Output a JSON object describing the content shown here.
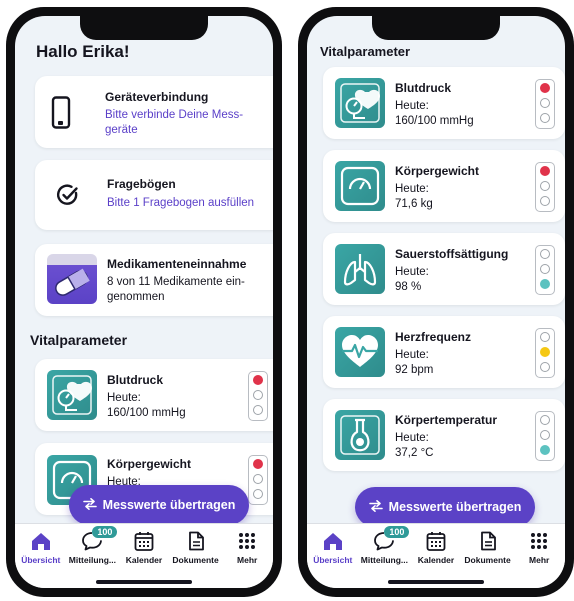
{
  "left_screen": {
    "greeting": "Hallo Erika!",
    "cards": [
      {
        "title": "Geräteverbindung",
        "subtitle_line1": "Bitte verbinde Deine Mess-",
        "subtitle_line2": "geräte",
        "icon": "phone-icon"
      },
      {
        "title": "Fragebögen",
        "subtitle": "Bitte 1 Fragebogen ausfüllen",
        "icon": "checkmark-circle-icon"
      },
      {
        "title": "Medikamenteneinnahme",
        "text_line1": "8 von 11 Medikamente ein-",
        "text_line2": "genommen",
        "icon": "pill-icon"
      }
    ],
    "section_title": "Vitalparameter",
    "vitals": [
      {
        "name": "Blutdruck",
        "label": "Heute:",
        "value": "160/100 mmHg",
        "status": "red"
      },
      {
        "name": "Körpergewicht",
        "label": "Heute:",
        "value": "",
        "status": "red"
      }
    ],
    "button_label": "Messwerte übertragen"
  },
  "right_screen": {
    "section_title": "Vitalparameter",
    "vitals": [
      {
        "name": "Blutdruck",
        "label": "Heute:",
        "value": "160/100 mmHg",
        "status": "red",
        "icon": "blood-pressure-icon"
      },
      {
        "name": "Körpergewicht",
        "label": "Heute:",
        "value": "71,6 kg",
        "status": "red",
        "icon": "scale-icon"
      },
      {
        "name": "Sauerstoffsättigung",
        "label": "Heute:",
        "value": "98 %",
        "status": "green",
        "icon": "lungs-icon"
      },
      {
        "name": "Herzfrequenz",
        "label": "Heute:",
        "value": "92 bpm",
        "status": "yellow",
        "icon": "heart-rate-icon"
      },
      {
        "name": "Körpertemperatur",
        "label": "Heute:",
        "value": "37,2 °C",
        "status": "green",
        "icon": "flask-icon"
      }
    ],
    "button_label": "Messwerte übertragen"
  },
  "tabbar": {
    "tabs": [
      {
        "label": "Übersicht",
        "icon": "home-icon",
        "active": true
      },
      {
        "label": "Mitteilung...",
        "icon": "chat-icon",
        "badge": "100"
      },
      {
        "label": "Kalender",
        "icon": "calendar-icon"
      },
      {
        "label": "Dokumente",
        "icon": "document-icon"
      },
      {
        "label": "Mehr",
        "icon": "grid-icon"
      }
    ]
  },
  "colors": {
    "accent_purple": "#5b42c6",
    "teal": "#3aa6a5",
    "status_red": "#e0334a",
    "status_yellow": "#f5c814",
    "status_green": "#5cc2c0",
    "link": "#5a3fc8"
  }
}
